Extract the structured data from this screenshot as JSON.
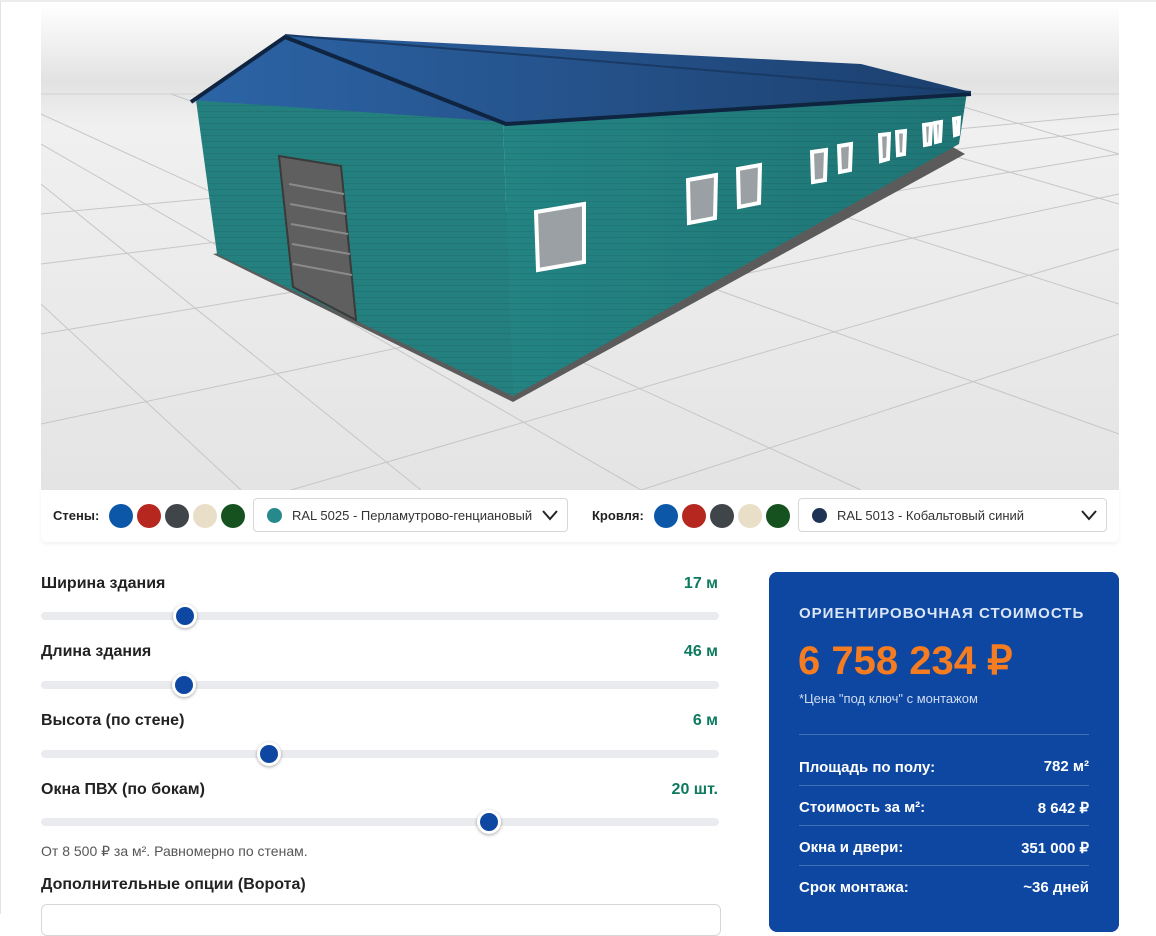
{
  "colorbar": {
    "walls_label": "Стены:",
    "walls_swatches": [
      {
        "name": "blue",
        "color": "#0d57a8"
      },
      {
        "name": "red",
        "color": "#b5271f"
      },
      {
        "name": "graphite",
        "color": "#40454a"
      },
      {
        "name": "ivory",
        "color": "#e9dfc8"
      },
      {
        "name": "green",
        "color": "#16521f"
      }
    ],
    "walls_select": {
      "value": "RAL 5025 - Перламутрово-генциановый",
      "color": "#26898b"
    },
    "roof_label": "Кровля:",
    "roof_swatches": [
      {
        "name": "blue",
        "color": "#0d57a8"
      },
      {
        "name": "red",
        "color": "#b5271f"
      },
      {
        "name": "graphite",
        "color": "#40454a"
      },
      {
        "name": "ivory",
        "color": "#e9dfc8"
      },
      {
        "name": "green",
        "color": "#16521f"
      }
    ],
    "roof_select": {
      "value": "RAL 5013 - Кобальтовый синий",
      "color": "#1e3355"
    }
  },
  "sliders": [
    {
      "label": "Ширина здания",
      "value_text": "17 м",
      "fraction": 0.213
    },
    {
      "label": "Длина здания",
      "value_text": "46 м",
      "fraction": 0.211
    },
    {
      "label": "Высота (по стене)",
      "value_text": "6 м",
      "fraction": 0.337
    },
    {
      "label": "Окна ПВХ (по бокам)",
      "value_text": "20 шт.",
      "fraction": 0.661
    }
  ],
  "note": "От 8 500 ₽ за м². Равномерно по стенам.",
  "options_title": "Дополнительные опции (Ворота)",
  "price": {
    "title": "ОРИЕНТИРОВОЧНАЯ СТОИМОСТЬ",
    "amount": "6 758 234 ₽",
    "subtitle": "*Цена \"под ключ\" с монтажом",
    "rows": [
      {
        "label": "Площадь по полу:",
        "value": "782 м²"
      },
      {
        "label": "Стоимость за м²:",
        "value": "8 642 ₽"
      },
      {
        "label": "Окна и двери:",
        "value": "351 000 ₽"
      },
      {
        "label": "Срок монтажа:",
        "value": "~36 дней"
      }
    ]
  },
  "colors": {
    "accent": "#0d47a1",
    "price": "#f57c20",
    "value_green": "#0d7a5f"
  }
}
